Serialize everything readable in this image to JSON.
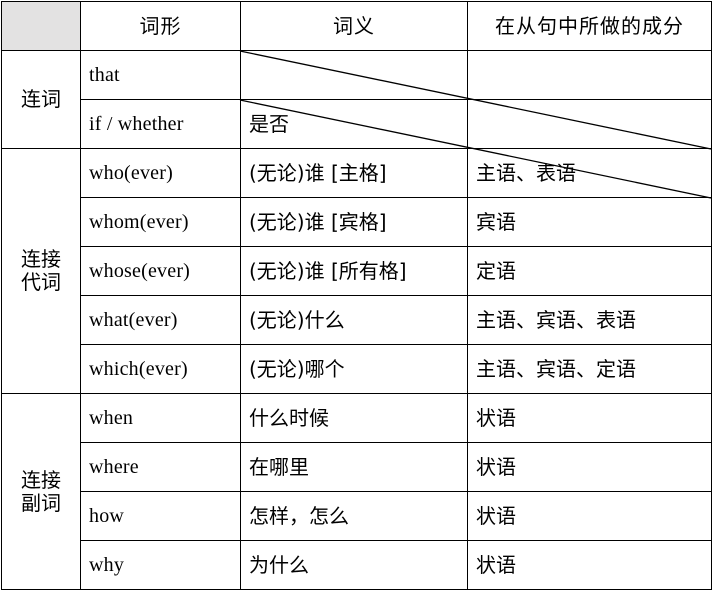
{
  "table": {
    "headers": {
      "category": "",
      "form": "词形",
      "meaning": "词义",
      "role": "在从句中所做的成分"
    },
    "header_color": "#ea0c10",
    "header_bg": "#e3e2e2",
    "category_bg": "#e3e2e2",
    "groups": [
      {
        "name": "连词",
        "name_lines": [
          "连词",
          ""
        ],
        "rows": [
          {
            "form": "that",
            "meaning": "",
            "role": "",
            "struck": true
          },
          {
            "form": "if / whether",
            "meaning": "是否",
            "role": "",
            "struck": true
          }
        ]
      },
      {
        "name": "连接代词",
        "name_lines": [
          "连接",
          "代词"
        ],
        "rows": [
          {
            "form": "who(ever)",
            "meaning": "(无论)谁  [主格]",
            "role": "主语、表语",
            "struck": false
          },
          {
            "form": "whom(ever)",
            "meaning": "(无论)谁  [宾格]",
            "role": "宾语",
            "struck": false
          },
          {
            "form": "whose(ever)",
            "meaning": "(无论)谁  [所有格]",
            "role": "定语",
            "struck": false
          },
          {
            "form": "what(ever)",
            "meaning": "(无论)什么",
            "role": "主语、宾语、表语",
            "struck": false
          },
          {
            "form": "which(ever)",
            "meaning": "(无论)哪个",
            "role": "主语、宾语、定语",
            "struck": false
          }
        ]
      },
      {
        "name": "连接副词",
        "name_lines": [
          "连接",
          "副词"
        ],
        "rows": [
          {
            "form": "when",
            "meaning": "什么时候",
            "role": "状语",
            "struck": false
          },
          {
            "form": "where",
            "meaning": "在哪里",
            "role": "状语",
            "struck": false
          },
          {
            "form": "how",
            "meaning": "怎样，怎么",
            "role": "状语",
            "struck": false
          },
          {
            "form": "why",
            "meaning": "为什么",
            "role": "状语",
            "struck": false
          }
        ]
      }
    ]
  }
}
